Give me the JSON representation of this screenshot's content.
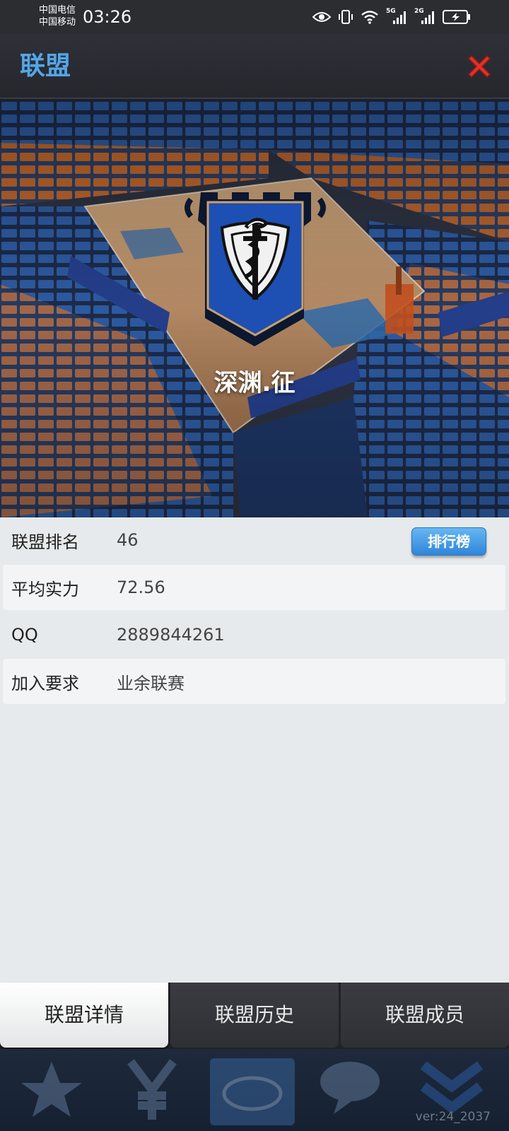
{
  "status_bar": {
    "carrier_1": "中国电信",
    "carrier_2": "中国移动",
    "time": "03:26",
    "icons": [
      "eye-icon",
      "vibrate-icon",
      "wifi-icon",
      "signal-5g-icon",
      "signal-2g-icon",
      "battery-charging-icon"
    ],
    "network_1": "5G",
    "network_2": "2G"
  },
  "header": {
    "title": "联盟",
    "close_icon": "close-icon"
  },
  "hero": {
    "team_name": "深渊.征",
    "emblem_icon": "league-emblem-icon"
  },
  "info": {
    "rows": [
      {
        "label": "联盟排名",
        "value": "46"
      },
      {
        "label": "平均实力",
        "value": "72.56"
      },
      {
        "label": "QQ",
        "value": "2889844261"
      },
      {
        "label": "加入要求",
        "value": "业余联赛"
      }
    ],
    "rank_button": "排行榜"
  },
  "tabs": [
    {
      "label": "联盟详情",
      "active": true
    },
    {
      "label": "联盟历史",
      "active": false
    },
    {
      "label": "联盟成员",
      "active": false
    }
  ],
  "bottom_nav": {
    "icons": [
      "star-icon",
      "yen-icon",
      "court-icon",
      "chat-icon",
      "chevron-down-icon"
    ]
  },
  "footer": {
    "version": "ver:24_2037"
  },
  "colors": {
    "accent": "#52a6e8",
    "close": "#e0312a",
    "panel": "#e7eaec",
    "row_alt": "#f2f4f5",
    "button": "#3a95e0"
  }
}
